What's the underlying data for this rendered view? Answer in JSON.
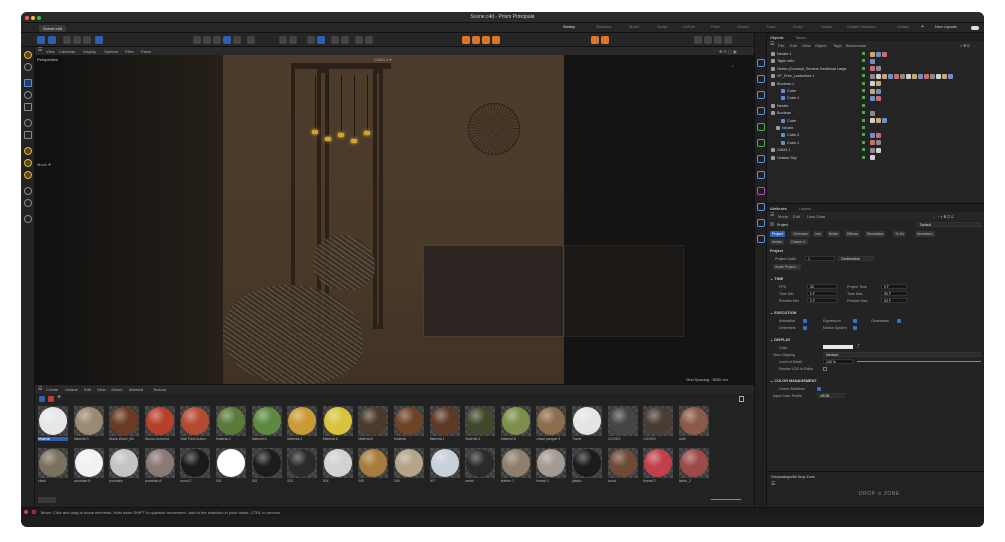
{
  "window": {
    "title": "Scene.c4d - Prism Principale"
  },
  "top_tabs": {
    "file": "Scene.c4d",
    "layouts": [
      "Startup",
      "Standard",
      "Model",
      "Sculpt",
      "UVEdit",
      "Paint",
      "Groom",
      "Track",
      "Script",
      "Nodes",
      "Octane Standard",
      "Octane"
    ],
    "new_layouts": "New Layouts"
  },
  "viewport": {
    "menu": [
      "View",
      "Cameras",
      "Display",
      "Options",
      "Filter",
      "Panel"
    ],
    "name": "Perspective",
    "camera": "CAM1.1 ⌖",
    "tool": "Move ✛",
    "grid": "Grid Spacing : 5000 cm"
  },
  "material_manager": {
    "menu": [
      "Create",
      "Octane",
      "Edit",
      "View",
      "Select",
      "Material",
      "Texture"
    ],
    "materials": [
      {
        "name": "Material",
        "color": "#e7e7e7",
        "selected": true
      },
      {
        "name": "Material.3",
        "color": "#9b8a72"
      },
      {
        "name": "Black-Wood_Mo",
        "color": "#6a3b22"
      },
      {
        "name": "Stucco Autumn1",
        "color": "#b7402c"
      },
      {
        "name": "Wall Paint Autum",
        "color": "#b44a30"
      },
      {
        "name": "Material.2",
        "color": "#5a7a3a"
      },
      {
        "name": "Material.5",
        "color": "#5c8a3e"
      },
      {
        "name": "Material.4",
        "color": "#c99b35"
      },
      {
        "name": "Material.6",
        "color": "#d8c43c"
      },
      {
        "name": "Material.6",
        "color": "#4b3a2c"
      },
      {
        "name": "Material",
        "color": "#6e4328"
      },
      {
        "name": "Material.1",
        "color": "#5d3a26"
      },
      {
        "name": "Material.3",
        "color": "#3f4a2c"
      },
      {
        "name": "Material.8",
        "color": "#7d8f4a"
      },
      {
        "name": "classi parquet 3",
        "color": "#8c6d4c"
      },
      {
        "name": "Travel",
        "color": "#e4e4e4"
      },
      {
        "name": "COVID3",
        "color": "#454545"
      },
      {
        "name": "COVID2",
        "color": "#4a3c34"
      },
      {
        "name": "cloth",
        "color": "#8c5a48"
      },
      {
        "name": "class",
        "color": "#7c715e"
      },
      {
        "name": "porcelain B",
        "color": "#f1f1f1"
      },
      {
        "name": "porcelain",
        "color": "#c4c4c4"
      },
      {
        "name": "porcelain A",
        "color": "#8a7874"
      },
      {
        "name": "wood 2",
        "color": "#1a1a1a"
      },
      {
        "name": "001",
        "color": "#ffffff"
      },
      {
        "name": "002",
        "color": "#1c1c1c"
      },
      {
        "name": "003",
        "color": "#2a2a2a"
      },
      {
        "name": "004",
        "color": "#d2d2d2"
      },
      {
        "name": "005",
        "color": "#a87c3c"
      },
      {
        "name": "006",
        "color": "#b5a38a"
      },
      {
        "name": "007",
        "color": "#c8d0d8"
      },
      {
        "name": "metal",
        "color": "#2a2a2a"
      },
      {
        "name": "leather 1",
        "color": "#8f7e6e"
      },
      {
        "name": "thread 1",
        "color": "#a39a92"
      },
      {
        "name": "plastic",
        "color": "#1b1b1b"
      },
      {
        "name": "wood",
        "color": "#6f4a36"
      },
      {
        "name": "thread 2",
        "color": "#c2404a"
      },
      {
        "name": "fabric_2",
        "color": "#9c4a4a"
      }
    ]
  },
  "status": {
    "text": "Move: Click and drag to move elements. Hold down SHIFT to quantize movement / add to the selection in point mode, CTRL to remove."
  },
  "objects": {
    "tabs": [
      "Objects",
      "Takes"
    ],
    "menu": [
      "File",
      "Edit",
      "View",
      "Object",
      "Tags",
      "Bookmarks"
    ],
    "rows": [
      {
        "name": "Neutre.1",
        "indent": 0
      },
      {
        "name": "Tapis rotin",
        "indent": 0
      },
      {
        "name": "Home-(Concept_Sirvane-Sectional Large",
        "indent": 0
      },
      {
        "name": "VF_Free_Lustonline.1",
        "indent": 0
      },
      {
        "name": "Boolean.1",
        "indent": 0
      },
      {
        "name": "Cube",
        "indent": 2
      },
      {
        "name": "Cube.1",
        "indent": 2
      },
      {
        "name": "Neutre",
        "indent": 0
      },
      {
        "name": "Boolean",
        "indent": 0
      },
      {
        "name": "Cube",
        "indent": 2
      },
      {
        "name": "Neutre",
        "indent": 1
      },
      {
        "name": "Cube.2",
        "indent": 2
      },
      {
        "name": "Cube.1",
        "indent": 2
      },
      {
        "name": "CAM1.1",
        "indent": 0
      },
      {
        "name": "Octane Sky",
        "indent": 0
      }
    ]
  },
  "attributes": {
    "tabs": [
      "Attributes",
      "Layers"
    ],
    "menu": [
      "Mode",
      "Edit",
      "User Data"
    ],
    "object_name": "Project",
    "preset": "Default",
    "pills": [
      "Project",
      "Cineware",
      "Info",
      "Bullet",
      "Effects",
      "Simulation",
      "To Do",
      "Animation",
      "Nodes",
      "Octane X"
    ],
    "heading": "Project",
    "scale_label": "Project Scale",
    "scale_value": "1",
    "scale_unit": "Centimeters",
    "scale_btn": "Scale Project...",
    "time_title": "TIME",
    "fps_label": "FPS",
    "fps_value": "30",
    "ptime_label": "Project Time",
    "ptime_value": "0 F",
    "tmin_label": "Time Min",
    "tmin_value": "0 F",
    "tmax_label": "Time Max",
    "tmax_value": "90 F",
    "pmin_label": "Preview Min",
    "pmin_value": "0 F",
    "pmax_label": "Preview Max",
    "pmax_value": "90 F",
    "exec_title": "EXECUTION",
    "animation": "Animation",
    "expression": "Expression",
    "generators": "Generators",
    "deformers": "Deformers",
    "motion": "Motion System",
    "display_title": "DISPLAY",
    "color_label": "Color",
    "clipping_label": "View Clipping",
    "clipping_value": "Medium",
    "lod_label": "Level of Detail",
    "lod_value": "100 %",
    "render_lod": "Render LOD in Editor",
    "cm_title": "COLOR MANAGEMENT",
    "linear": "Linear Workflow",
    "profile_label": "Input Color Profile",
    "profile_value": "sRGB",
    "dropzone_title": "Greyscalegorilla Drop Zone",
    "dropzone_logo": "DROP ⊙ ZONE"
  }
}
